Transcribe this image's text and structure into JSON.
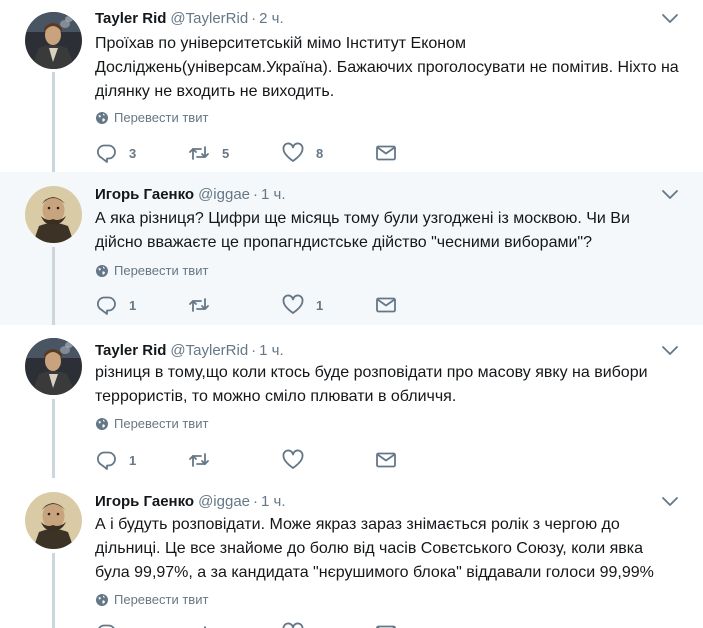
{
  "translate_label": "Перевести твит",
  "tweets": [
    {
      "name": "Tayler Rid",
      "handle": "@TaylerRid",
      "separator": "·",
      "time": "2 ч.",
      "text": "Проїхав по університетській мімо Інститут Економ Досліджень(універсам.Україна). Бажаючих проголосувати не помітив. Ніхто на ділянку не входить не виходить.",
      "replies": "3",
      "retweets": "5",
      "likes": "8"
    },
    {
      "name": "Игорь Гаенко",
      "handle": "@iggae",
      "separator": "·",
      "time": "1 ч.",
      "text": "А яка різниця? Цифри ще місяць тому були узгоджені із москвою. Чи Ви дійсно вважаєте це пропагндистське дійство \"чесними виборами\"?",
      "replies": "1",
      "retweets": "",
      "likes": "1"
    },
    {
      "name": "Tayler Rid",
      "handle": "@TaylerRid",
      "separator": "·",
      "time": "1 ч.",
      "text": "різниця в тому,що коли ктось буде розповідати про масову явку на вибори террористів, то можно сміло плювати в обличчя.",
      "replies": "1",
      "retweets": "",
      "likes": ""
    },
    {
      "name": "Игорь Гаенко",
      "handle": "@iggae",
      "separator": "·",
      "time": "1 ч.",
      "text": "А і будуть розповідати. Може якраз зараз знімається ролік з чергою до дільниці. Це все знайоме до болю від часів Совєтського Союзу, коли явка була 99,97%, а за кандидата \"нєрушимого блока\" віддавали голоси 99,99%"
    }
  ]
}
